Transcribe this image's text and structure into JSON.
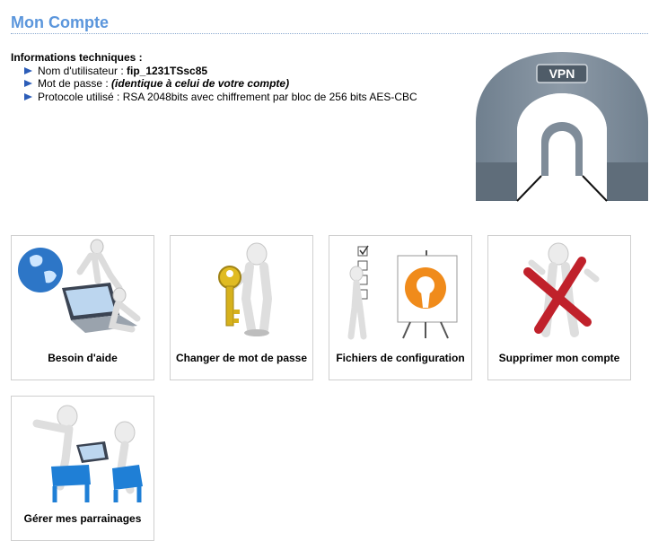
{
  "page": {
    "title": "Mon Compte"
  },
  "info": {
    "heading": "Informations techniques :",
    "items": [
      {
        "label": "Nom d'utilisateur : ",
        "value": "fip_1231TSsc85"
      },
      {
        "label": "Mot de passe : ",
        "value": "(identique à celui de votre compte)"
      },
      {
        "label": "Protocole utilisé : RSA 2048bits avec chiffrement par bloc de 256 bits AES-CBC",
        "value": ""
      }
    ]
  },
  "vpn_badge": {
    "text": "VPN"
  },
  "tiles": [
    {
      "label": "Besoin d'aide",
      "icon": "help-globe-laptop-icon"
    },
    {
      "label": "Changer de mot de passe",
      "icon": "key-icon"
    },
    {
      "label": "Fichiers de configuration",
      "icon": "config-checklist-icon"
    },
    {
      "label": "Supprimer mon compte",
      "icon": "delete-cross-icon"
    },
    {
      "label": "Gérer mes parrainages",
      "icon": "referral-people-icon"
    }
  ]
}
